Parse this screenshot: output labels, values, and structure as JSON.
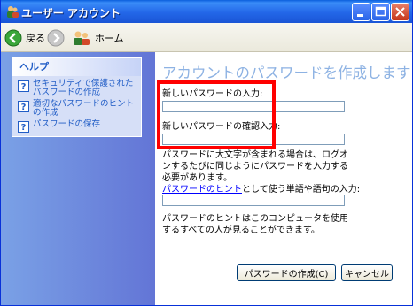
{
  "window": {
    "title": "ユーザー アカウント"
  },
  "toolbar": {
    "back_label": "戻る",
    "home_label": "ホーム"
  },
  "sidebar": {
    "panel_title": "ヘルプ",
    "items": [
      {
        "label": "セキュリティで保護されたパスワードの作成",
        "icon": "help-icon"
      },
      {
        "label": "適切なパスワードのヒントの作成",
        "icon": "help-icon"
      },
      {
        "label": "パスワードの保存",
        "icon": "help-icon"
      }
    ]
  },
  "main": {
    "title": "アカウントのパスワードを作成します",
    "new_password_label": "新しいパスワードの入力:",
    "new_password_value": "",
    "confirm_password_label": "新しいパスワードの確認入力:",
    "confirm_password_value": "",
    "caps_note": "パスワードに大文字が含まれる場合は、ログオンするたびに同じようにパスワードを入力する必要があります。",
    "hint_link": "パスワードのヒント",
    "hint_label_rest": "として使う単語や語句の入力:",
    "hint_value": "",
    "hint_note": "パスワードのヒントはこのコンピュータを使用するすべての人が見ることができます。",
    "create_button": "パスワードの作成(C)",
    "cancel_button": "キャンセル"
  },
  "colors": {
    "highlight": "#ff0000",
    "title": "#8db2e3",
    "link": "#0000ff",
    "sidebar": "#6f8fdf"
  }
}
